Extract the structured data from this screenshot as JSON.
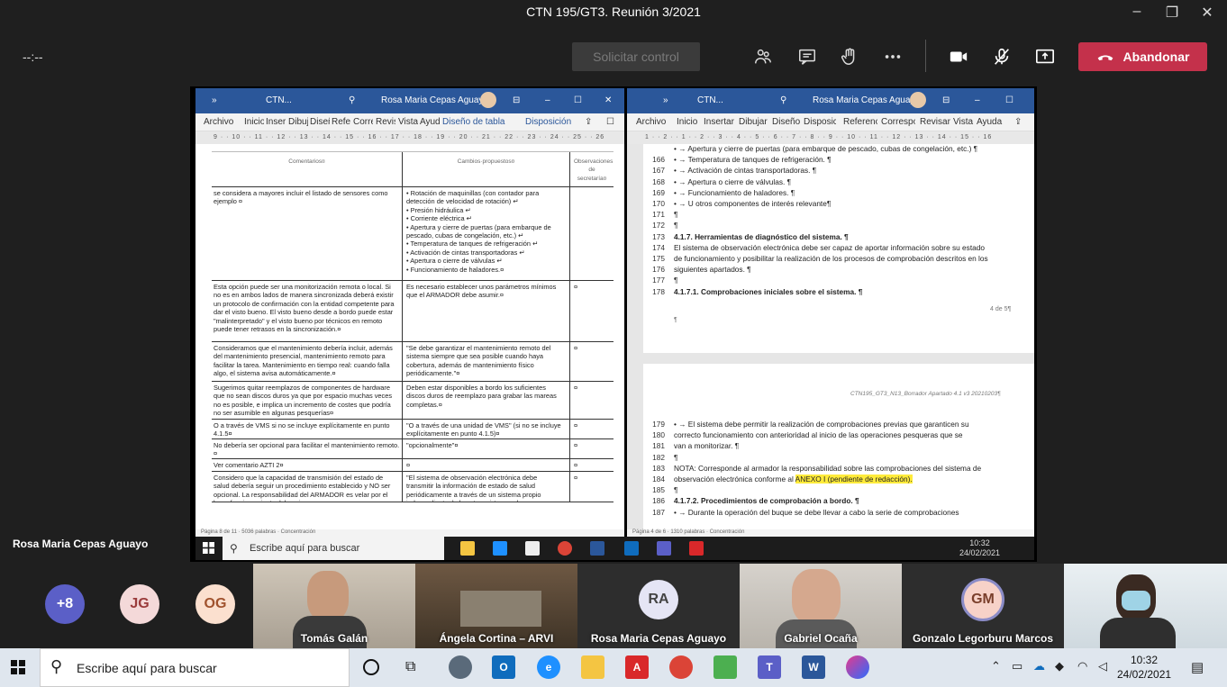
{
  "window": {
    "title": "CTN 195/GT3. Reunión 3/2021"
  },
  "meeting": {
    "timer": "--:--",
    "request_control": "Solicitar control",
    "leave_label": "Abandonar"
  },
  "presenter_name": "Rosa Maria Cepas Aguayo",
  "word_left": {
    "title_short": "CTN...",
    "user": "Rosa Maria Cepas Aguayo",
    "tabs": [
      "Archivo",
      "Inicio",
      "Insertar",
      "Dibujar",
      "Diseño",
      "Referencias",
      "Correspondencia",
      "Revisar",
      "Vista",
      "Ayuda",
      "Diseño de tabla",
      "Disposición"
    ],
    "ruler": "9 · · 10 · · 11 · · 12 · · 13 · · 14 · · 15 · · 16 · · 17 · · 18 · · 19 · · 20 · · 21 · · 22 · · 23 · · 24 · · 25 · · 26",
    "headers": [
      "Comentarios¤",
      "Cambios·propuestos¤",
      "Observaciones de secretaría¤"
    ],
    "rows": [
      {
        "c1": "se considera a mayores incluir el listado de sensores como ejemplo ¤",
        "c2": "• Rotación de maquinillas (con contador para detección de velocidad de rotación) ↵\n• Presión hidráulica ↵\n• Corriente eléctrica ↵\n• Apertura y cierre de puertas (para embarque de pescado, cubas de congelación, etc.) ↵\n• Temperatura de tanques de refrigeración ↵\n• Activación de cintas transportadoras ↵\n• Apertura o cierre de válvulas ↵\n• Funcionamiento de haladores.¤",
        "c3": ""
      },
      {
        "c1": "Esta opción puede ser una monitorización remota o local. Si no es en ambos lados de manera sincronizada deberá existir un protocolo de confirmación con la entidad competente para dar el visto bueno. El visto bueno desde a bordo puede estar \"malinterpretado\" y el visto bueno por técnicos en remoto puede tener retrasos en la sincronización.¤",
        "c2": "Es necesario establecer unos parámetros mínimos que el ARMADOR debe asumir.¤",
        "c3": "¤"
      },
      {
        "c1": "Consideramos que el mantenimiento debería incluir, además del mantenimiento presencial, mantenimiento remoto para facilitar la tarea. Mantenimiento en tiempo real: cuando falla algo, el sistema avisa automáticamente.¤",
        "c2": "\"Se debe garantizar el mantenimiento remoto del sistema siempre que sea posible cuando haya cobertura, además de mantenimiento físico periódicamente.\"¤",
        "c3": "¤"
      },
      {
        "c1": "Sugerimos quitar reemplazos de componentes de hardware que no sean discos duros ya que por espacio muchas veces no es posible, e implica un incremento de costes que podría no ser asumible en algunas pesquerías¤",
        "c2": "Deben estar disponibles a bordo los suficientes discos duros de reemplazo para grabar las mareas completas.¤",
        "c3": "¤"
      },
      {
        "c1": "O a través de VMS si no se incluye explícitamente en punto 4.1.5¤",
        "c2": "\"O a través de una unidad de VMS\" (si no se incluye explícitamente en punto 4.1.5)¤",
        "c3": "¤"
      },
      {
        "c1": "No debería ser opcional para facilitar el mantenimiento remoto.¤",
        "c2": "\"opcionalmente\"¤",
        "c3": "¤"
      },
      {
        "c1": "Ver comentario AZTI 2¤",
        "c2": "¤",
        "c3": "¤"
      },
      {
        "c1": "Considero que la capacidad de transmisión del estado de salud debería seguir un procedimiento establecido y NO ser opcional. La responsabilidad del ARMADOR es velar por el buen funcionamiento del equipo pero creo que es",
        "c2": "\"El sistema de observación electrónica debe transmitir la información de estado de salud periódicamente a través de un sistema propio independiente de los otros sistemas de",
        "c3": "¤"
      }
    ],
    "status": "Página 8 de 11 · 5036 palabras · Concentración"
  },
  "word_right": {
    "title_short": "CTN...",
    "user": "Rosa Maria Cepas Aguayo",
    "tabs": [
      "Archivo",
      "Inicio",
      "Insertar",
      "Dibujar",
      "Diseño",
      "Disposición",
      "Referencias",
      "Correspondencia",
      "Revisar",
      "Vista",
      "Ayuda"
    ],
    "ruler": "1 · · 2 · · 1 · · 2 · · 3 · · 4 · · 5 · · 6 · · 7 · · 8 · · 9 · · 10 · · 11 · · 12 · · 13 · · 14 · · 15 · · 16",
    "lines_top": [
      {
        "n": "",
        "t": "• → Apertura y cierre de puertas (para embarque de pescado, cubas de congelación, etc.) ¶"
      },
      {
        "n": "166",
        "t": "• → Temperatura de tanques de refrigeración. ¶"
      },
      {
        "n": "167",
        "t": "• → Activación de cintas transportadoras. ¶"
      },
      {
        "n": "168",
        "t": "• → Apertura o cierre de válvulas. ¶"
      },
      {
        "n": "169",
        "t": "• → Funcionamiento de haladores. ¶"
      },
      {
        "n": "170",
        "t": "• → U otros componentes de interés relevante¶"
      },
      {
        "n": "171",
        "t": "¶"
      },
      {
        "n": "172",
        "t": "¶"
      },
      {
        "n": "173",
        "t": "4.1.7. Herramientas de diagnóstico del sistema. ¶"
      },
      {
        "n": "174",
        "t": "El sistema de observación electrónica debe ser capaz de aportar información sobre su estado"
      },
      {
        "n": "175",
        "t": "de funcionamiento y posibilitar la realización de los procesos de comprobación descritos en los"
      },
      {
        "n": "176",
        "t": "siguientes apartados. ¶"
      },
      {
        "n": "177",
        "t": "¶"
      },
      {
        "n": "178",
        "t": "4.1.7.1. Comprobaciones iniciales sobre el sistema. ¶"
      }
    ],
    "page_num": "4 de 5¶",
    "para_mark": "¶",
    "header_text": "CTN195_GT3_N13_Borrador Apartado 4.1 v3 20210203¶",
    "lines_bottom": [
      {
        "n": "179",
        "t": "• → El sistema debe permitir la realización de comprobaciones previas que garanticen su"
      },
      {
        "n": "180",
        "t": "correcto funcionamiento con anterioridad al inicio de las operaciones pesqueras que se"
      },
      {
        "n": "181",
        "t": "van a monitorizar. ¶"
      },
      {
        "n": "182",
        "t": "¶"
      },
      {
        "n": "183",
        "t": "NOTA: Corresponde al armador la responsabilidad sobre las comprobaciones del sistema de"
      },
      {
        "n": "184",
        "t": "observación electrónica conforme al ",
        "hl": "ANEXO I (pendiente de redacción)."
      },
      {
        "n": "185",
        "t": "¶"
      },
      {
        "n": "186",
        "t": "4.1.7.2. Procedimientos de comprobación a bordo. ¶"
      },
      {
        "n": "187",
        "t": "• → Durante la operación del buque se debe llevar a cabo la serie de comprobaciones"
      }
    ],
    "status": "Página 4 de 6 · 1310 palabras · Concentración"
  },
  "inner_taskbar": {
    "search": "Escribe aquí para buscar",
    "time": "10:32",
    "date": "24/02/2021"
  },
  "participants": {
    "overflow": "+8",
    "avatars": [
      {
        "initials": "JG",
        "bg": "#f4d9d9",
        "fg": "#9a3b3b"
      },
      {
        "initials": "OG",
        "bg": "#fbe0cf",
        "fg": "#a0522d"
      }
    ],
    "videos": [
      {
        "name": "Tomás Galán"
      },
      {
        "name": "Ángela Cortina – ARVI"
      },
      {
        "name": "Rosa Maria Cepas Aguayo",
        "initials": "RA"
      },
      {
        "name": "Gabriel Ocaña"
      },
      {
        "name": "Gonzalo Legorburu Marcos",
        "initials": "GM"
      },
      {
        "name": ""
      }
    ]
  },
  "taskbar": {
    "search": "Escribe aquí para buscar",
    "time": "10:32",
    "date": "24/02/2021"
  },
  "colors": {
    "leave": "#c4314b",
    "word": "#2b579a",
    "teams": "#1f1f1f"
  }
}
